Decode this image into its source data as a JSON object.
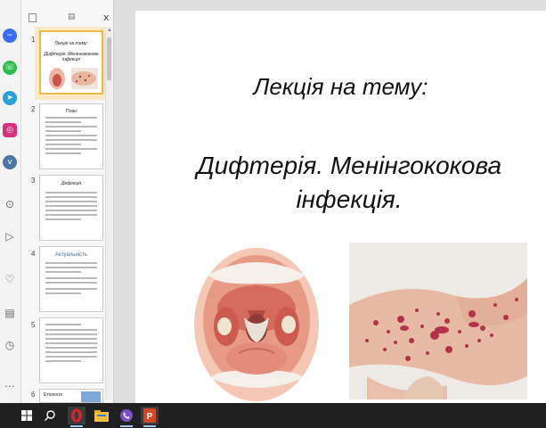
{
  "thumbnails": {
    "items": [
      {
        "num": "1",
        "title": "Лекція на тему:",
        "subtitle": "Дифтерія. Менінгококова інфекція"
      },
      {
        "num": "2",
        "title": "План"
      },
      {
        "num": "3",
        "title": "Дефініція"
      },
      {
        "num": "4",
        "title": "Актуальність"
      },
      {
        "num": "5",
        "title": ""
      },
      {
        "num": "6",
        "title": "Етіологія"
      }
    ],
    "close_glyph": "x"
  },
  "slide": {
    "title": "Лекція на тему:",
    "subtitle": "Дифтерія. Менінгококова інфекція."
  },
  "sidebar_icons": [
    "messenger-icon",
    "whatsapp-icon",
    "telegram-icon",
    "instagram-icon",
    "vk-icon",
    "history-icon",
    "play-icon",
    "heart-icon",
    "notes-icon",
    "clock-icon"
  ],
  "taskbar": {
    "items": [
      "start-icon",
      "search-icon",
      "opera-icon",
      "file-explorer-icon",
      "viber-icon",
      "powerpoint-icon"
    ]
  },
  "colors": {
    "selection": "#e9b84a",
    "taskbar": "#202020",
    "messenger": "#3b6cf5",
    "whatsapp": "#2ebc4f",
    "telegram": "#2a9fd8",
    "instagram": "#d6307f",
    "vk": "#4c75a3",
    "opera": "#d8242c",
    "powerpoint": "#d24726"
  }
}
